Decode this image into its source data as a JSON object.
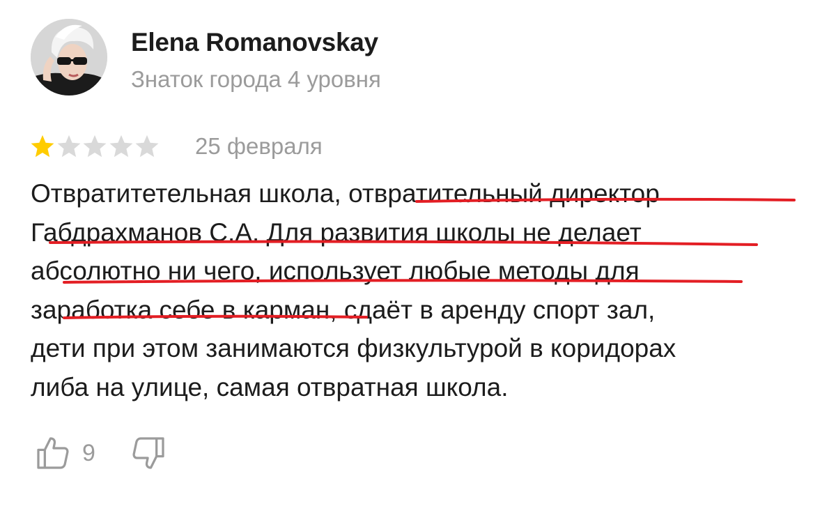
{
  "author": {
    "name": "Elena Romanovskay",
    "level": "Знаток города 4 уровня"
  },
  "review": {
    "rating": 1,
    "rating_max": 5,
    "date": "25 февраля",
    "lines": [
      "Отвратитетельная школа, отвратительный директор",
      "Габдрахманов С.А. Для развития школы не делает",
      "абсолютно ни чего, использует любые методы для",
      "заработка себе в карман, сдаёт в аренду спорт зал,",
      "дети при этом занимаются физкультурой в коридорах",
      "либа на улице, самая отвратная школа."
    ]
  },
  "actions": {
    "likes": "9",
    "like_icon": "thumbs-up-icon",
    "dislike_icon": "thumbs-down-icon"
  },
  "colors": {
    "star_filled": "#FFCC00",
    "star_empty": "#D9D9D9",
    "underline": "#E31E24",
    "secondary_text": "#9B9B9B"
  }
}
